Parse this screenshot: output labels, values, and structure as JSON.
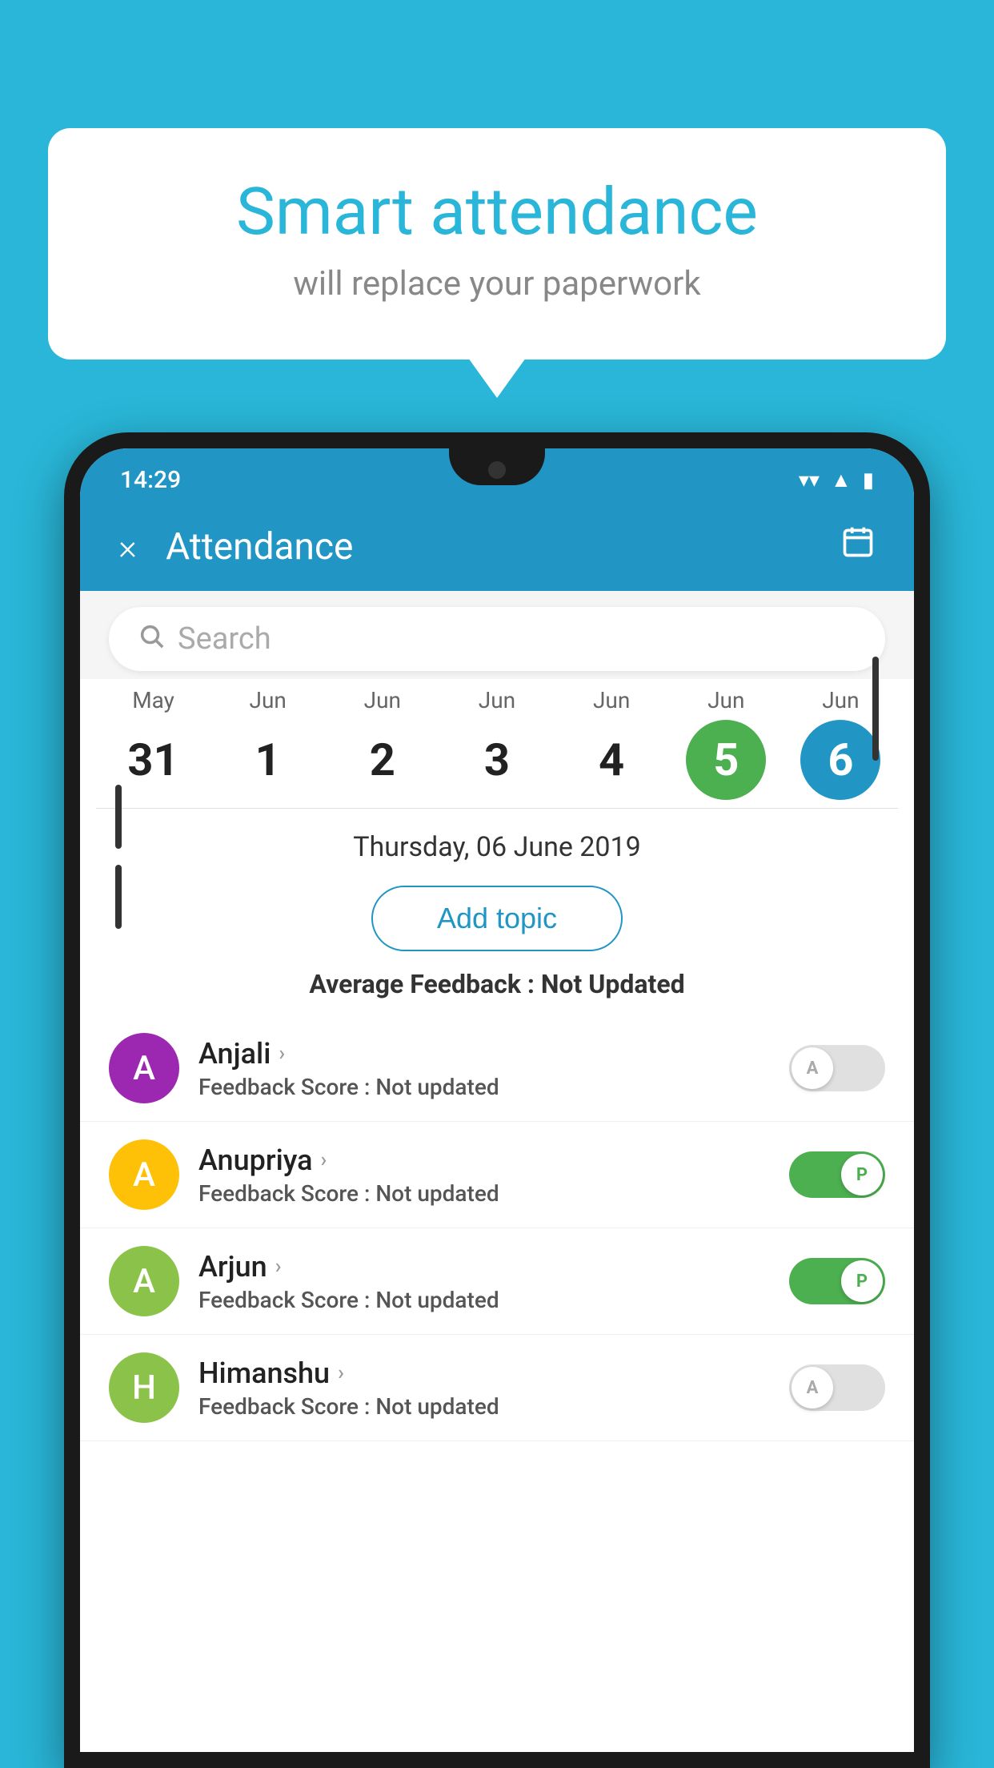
{
  "background_color": "#29b6d8",
  "bubble": {
    "title": "Smart attendance",
    "subtitle": "will replace your paperwork"
  },
  "status_bar": {
    "time": "14:29",
    "icons": [
      "wifi",
      "signal",
      "battery"
    ]
  },
  "header": {
    "title": "Attendance",
    "close_label": "×",
    "calendar_icon": "📅"
  },
  "search": {
    "placeholder": "Search"
  },
  "calendar": {
    "dates": [
      {
        "month": "May",
        "day": "31",
        "style": "normal"
      },
      {
        "month": "Jun",
        "day": "1",
        "style": "normal"
      },
      {
        "month": "Jun",
        "day": "2",
        "style": "normal"
      },
      {
        "month": "Jun",
        "day": "3",
        "style": "normal"
      },
      {
        "month": "Jun",
        "day": "4",
        "style": "normal"
      },
      {
        "month": "Jun",
        "day": "5",
        "style": "selected-green"
      },
      {
        "month": "Jun",
        "day": "6",
        "style": "selected-blue"
      }
    ]
  },
  "selected_date": "Thursday, 06 June 2019",
  "add_topic_label": "Add topic",
  "avg_feedback_label": "Average Feedback : ",
  "avg_feedback_value": "Not Updated",
  "students": [
    {
      "name": "Anjali",
      "avatar_letter": "A",
      "avatar_color": "#9c27b0",
      "feedback": "Not updated",
      "toggle": "off",
      "toggle_label": "A"
    },
    {
      "name": "Anupriya",
      "avatar_letter": "A",
      "avatar_color": "#ffc107",
      "feedback": "Not updated",
      "toggle": "on",
      "toggle_label": "P"
    },
    {
      "name": "Arjun",
      "avatar_letter": "A",
      "avatar_color": "#8bc34a",
      "feedback": "Not updated",
      "toggle": "on",
      "toggle_label": "P"
    },
    {
      "name": "Himanshu",
      "avatar_letter": "H",
      "avatar_color": "#8bc34a",
      "feedback": "Not updated",
      "toggle": "off",
      "toggle_label": "A"
    }
  ],
  "feedback_score_label": "Feedback Score : "
}
